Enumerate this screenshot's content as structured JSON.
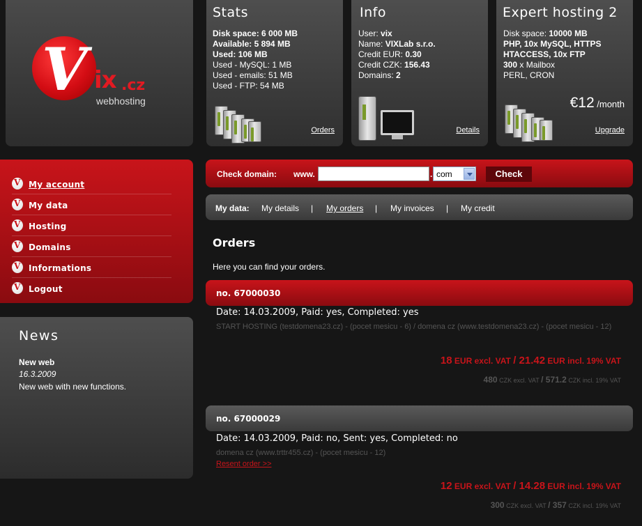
{
  "logo": {
    "letter": "V",
    "ix": "ix",
    "tld": ".cz",
    "tagline": "webhosting"
  },
  "stats": {
    "title": "Stats",
    "lines": [
      {
        "label": "Disk space: ",
        "value": "6 000 MB",
        "bold": true
      },
      {
        "label": "Available: ",
        "value": "5 894 MB",
        "bold": true
      },
      {
        "label": "Used: ",
        "value": "106 MB",
        "bold": true
      },
      {
        "label": "Used - MySQL: ",
        "value": "1 MB",
        "bold": false
      },
      {
        "label": "Used - emails: ",
        "value": "51 MB",
        "bold": false
      },
      {
        "label": "Used - FTP: ",
        "value": "54 MB",
        "bold": false
      }
    ],
    "link": "Orders"
  },
  "info": {
    "title": "Info",
    "lines": [
      {
        "label": "User: ",
        "value": "vix"
      },
      {
        "label": "Name: ",
        "value": "VIXLab s.r.o."
      },
      {
        "label": "Credit EUR: ",
        "value": "0.30"
      },
      {
        "label": "Credit CZK: ",
        "value": "156.43"
      },
      {
        "label": "Domains: ",
        "value": "2"
      }
    ],
    "link": "Details"
  },
  "plan": {
    "title": "Expert hosting 2",
    "line1_label": "Disk space: ",
    "line1_value": "10000 MB",
    "line2": "PHP, 10x MySQL, HTTPS",
    "line3": "HTACCESS, 10x FTP",
    "line4_value": "300",
    "line4_label": " x Mailbox",
    "line5": "PERL, CRON",
    "price": "€12",
    "per": " /month",
    "link": "Upgrade"
  },
  "menu": {
    "items": [
      {
        "label": "My account",
        "active": true
      },
      {
        "label": "My data"
      },
      {
        "label": "Hosting"
      },
      {
        "label": "Domains"
      },
      {
        "label": "Informations"
      },
      {
        "label": "Logout"
      }
    ]
  },
  "news": {
    "title": "News",
    "headline": "New web",
    "date": "16.3.2009",
    "text": "New web with new functions."
  },
  "domain_check": {
    "label": "Check domain:",
    "prefix": "www.",
    "input_value": "",
    "dot": ".",
    "tld_selected": "com",
    "button": "Check"
  },
  "mydata": {
    "label": "My data:",
    "links": [
      "My details",
      "My orders",
      "My invoices",
      "My credit"
    ],
    "separator": "|"
  },
  "page": {
    "title": "Orders",
    "intro": "Here you can find your orders."
  },
  "orders": [
    {
      "title": "no. 67000030",
      "meta": "Date: 14.03.2009, Paid: yes, Completed: yes",
      "desc": "START HOSTING (testdomena23.cz) - (pocet mesicu - 6) / domena cz (www.testdomena23.cz) - (pocet mesicu - 12)",
      "link": "",
      "eur_excl": "18",
      "eur_excl_label": " EUR excl. VAT ",
      "slash": "/",
      "eur_incl": " 21.42",
      "eur_incl_label": " EUR incl. 19% VAT",
      "czk_excl": "480",
      "czk_excl_label": " CZK excl. VAT ",
      "czk_incl": " 571.2",
      "czk_incl_label": " CZK incl. 19% VAT"
    },
    {
      "title": "no. 67000029",
      "meta": "Date: 14.03.2009, Paid: no, Sent: yes, Completed: no",
      "desc": "domena cz (www.trttr455.cz) - (pocet mesicu - 12)",
      "link": "Resent order >>",
      "eur_excl": "12",
      "eur_excl_label": " EUR excl. VAT ",
      "slash": "/",
      "eur_incl": " 14.28",
      "eur_incl_label": " EUR incl. 19% VAT",
      "czk_excl": "300",
      "czk_excl_label": " CZK excl. VAT ",
      "czk_incl": " 357",
      "czk_incl_label": " CZK incl. 19% VAT"
    }
  ]
}
